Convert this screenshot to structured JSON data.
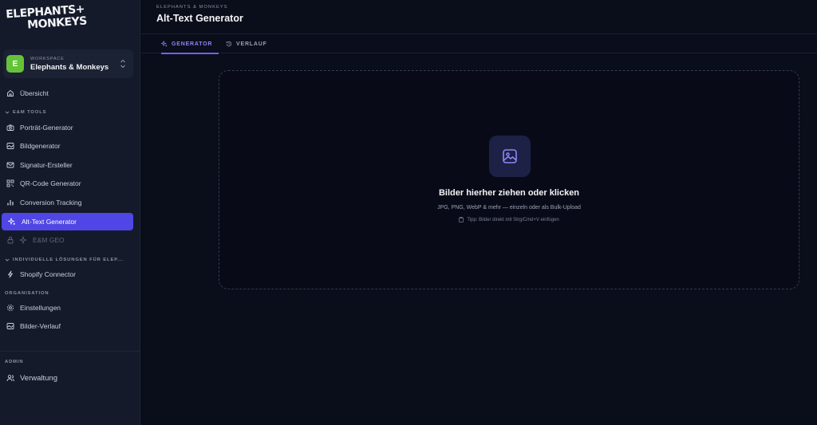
{
  "brand": {
    "logo_line1": "ELEPHANTS+",
    "logo_line2": "MONKEYS"
  },
  "workspace": {
    "label": "WORKSPACE",
    "name": "Elephants & Monkeys",
    "avatar_letter": "E",
    "avatar_color": "#65c23a"
  },
  "sidebar": {
    "overview": "Übersicht",
    "section_tools": "E&M TOOLS",
    "tools": [
      {
        "label": "Porträt-Generator",
        "icon": "camera-icon"
      },
      {
        "label": "Bildgenerator",
        "icon": "image-icon"
      },
      {
        "label": "Signatur-Ersteller",
        "icon": "mail-icon"
      },
      {
        "label": "QR-Code Generator",
        "icon": "qr-code-icon"
      },
      {
        "label": "Conversion Tracking",
        "icon": "bar-chart-icon"
      },
      {
        "label": "Alt-Text Generator",
        "icon": "sparkle-icon",
        "active": true
      },
      {
        "label": "E&M GEO",
        "icon": "sparkle-icon",
        "locked": true
      }
    ],
    "section_custom": "INDIVIDUELLE LÖSUNGEN FÜR ELEP...",
    "custom": [
      {
        "label": "Shopify Connector",
        "icon": "bolt-icon"
      }
    ],
    "section_org": "ORGANISATION",
    "org": [
      {
        "label": "Einstellungen",
        "icon": "gear-icon"
      },
      {
        "label": "Bilder-Verlauf",
        "icon": "image-icon"
      }
    ],
    "section_admin": "ADMIN",
    "admin": [
      {
        "label": "Verwaltung",
        "icon": "users-icon"
      }
    ]
  },
  "header": {
    "breadcrumb": "ELEPHANTS & MONKEYS",
    "title": "Alt-Text Generator"
  },
  "tabs": [
    {
      "label": "GENERATOR",
      "active": true,
      "icon": "sparkle-icon"
    },
    {
      "label": "VERLAUF",
      "active": false,
      "icon": "history-icon"
    }
  ],
  "dropzone": {
    "title": "Bilder hierher ziehen oder klicken",
    "subtitle": "JPG, PNG, WebP & mehr — einzeln oder als Bulk-Upload",
    "tip": "Tipp: Bilder direkt mit Strg/Cmd+V einfügen",
    "icon": "image-icon"
  },
  "colors": {
    "accent": "#4f46e5",
    "background": "#0a0d1a",
    "sidebar": "#141a2a"
  }
}
